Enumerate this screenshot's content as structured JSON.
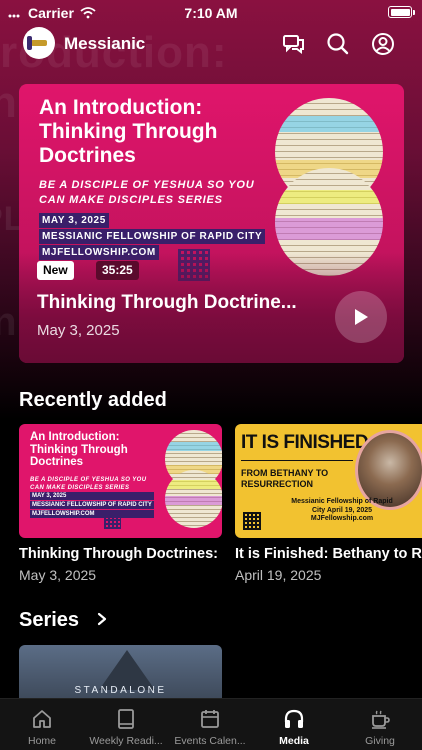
{
  "status_bar": {
    "carrier": "Carrier",
    "time": "7:10 AM"
  },
  "header": {
    "title": "Messianic"
  },
  "hero": {
    "art_title": "An Introduction: Thinking Through Doctrines",
    "art_subtitle": "BE A DISCIPLE OF YESHUA SO YOU CAN MAKE DISCIPLES SERIES",
    "art_meta": [
      "MAY 3, 2025",
      "MESSIANIC FELLOWSHIP OF RAPID CITY",
      "MJFELLOWSHIP.COM"
    ],
    "badge_new": "New",
    "duration": "35:25",
    "title": "Thinking Through Doctrine...",
    "date": "May 3, 2025"
  },
  "recently_added": {
    "heading": "Recently added",
    "items": [
      {
        "art_title": "An Introduction: Thinking Through Doctrines",
        "art_subtitle": "BE A DISCIPLE OF YESHUA SO YOU CAN MAKE DISCIPLES SERIES",
        "art_meta": [
          "MAY 3, 2025",
          "MESSIANIC FELLOWSHIP OF RAPID CITY",
          "MJFELLOWSHIP.COM"
        ],
        "title": "Thinking Through Doctrines:",
        "date": "May 3, 2025"
      },
      {
        "art_title": "IT IS FINISHED",
        "art_subtitle": "FROM BETHANY TO RESURRECTION",
        "art_info": "Messianic Fellowship of Rapid City April 19, 2025 MJFellowship.com",
        "title": "It is Finished: Bethany to Re",
        "date": "April 19, 2025"
      }
    ]
  },
  "series": {
    "heading": "Series",
    "items": [
      {
        "label": "STANDALONE"
      }
    ]
  },
  "tabbar": {
    "tabs": [
      {
        "label": "Home",
        "icon": "home-icon"
      },
      {
        "label": "Weekly Readi...",
        "icon": "book-icon"
      },
      {
        "label": "Events Calen...",
        "icon": "calendar-icon"
      },
      {
        "label": "Media",
        "icon": "headphones-icon",
        "active": true
      },
      {
        "label": "Giving",
        "icon": "coffee-cup-icon"
      }
    ]
  },
  "colors": {
    "accent": "#e0156b",
    "background": "#000000",
    "tab_active": "#ffffff",
    "tab_inactive": "#9a9a9a"
  }
}
